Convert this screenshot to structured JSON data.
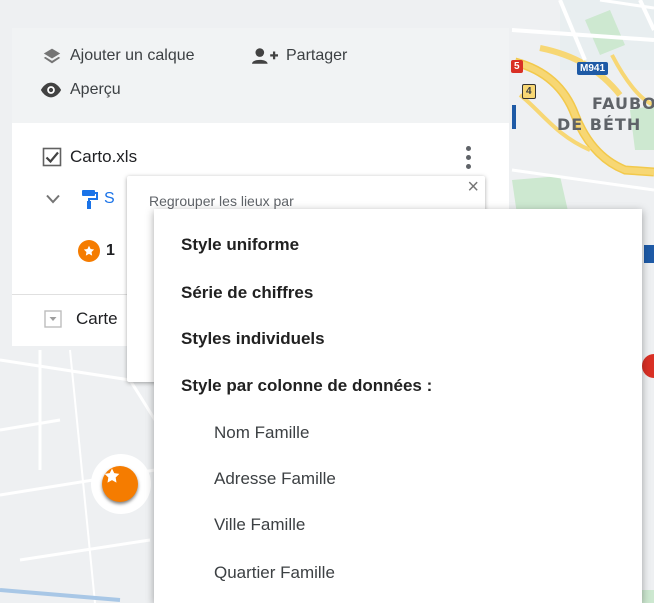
{
  "toolbar": {
    "add_layer_label": "Ajouter un calque",
    "share_label": "Partager",
    "preview_label": "Aperçu"
  },
  "layer1": {
    "name": "Carto.xls",
    "checked": true,
    "style_link_label": "S",
    "category_label": "1"
  },
  "layer2": {
    "name": "Carte",
    "checked": false
  },
  "popup": {
    "header": "Regrouper les lieux par",
    "partial_text": "l",
    "close_icon": "×"
  },
  "menu": {
    "items": [
      "Style uniforme",
      "Série de chiffres",
      "Styles individuels"
    ],
    "column_header": "Style par colonne de données :",
    "columns": [
      "Nom Famille",
      "Adresse Famille",
      "Ville Famille",
      "Quartier Famille"
    ]
  },
  "map": {
    "road_shield_m941": "M941",
    "road_shield_5": "5",
    "road_shield_4": "4",
    "label_line1": "FAUBOU",
    "label_line2": "DE BÉTH"
  },
  "colors": {
    "accent_orange": "#f57c00",
    "link_blue": "#1a73e8",
    "road_yellow": "#f7d774",
    "road_shield_blue": "#1e5aa6",
    "road_shield_red": "#d93025"
  }
}
